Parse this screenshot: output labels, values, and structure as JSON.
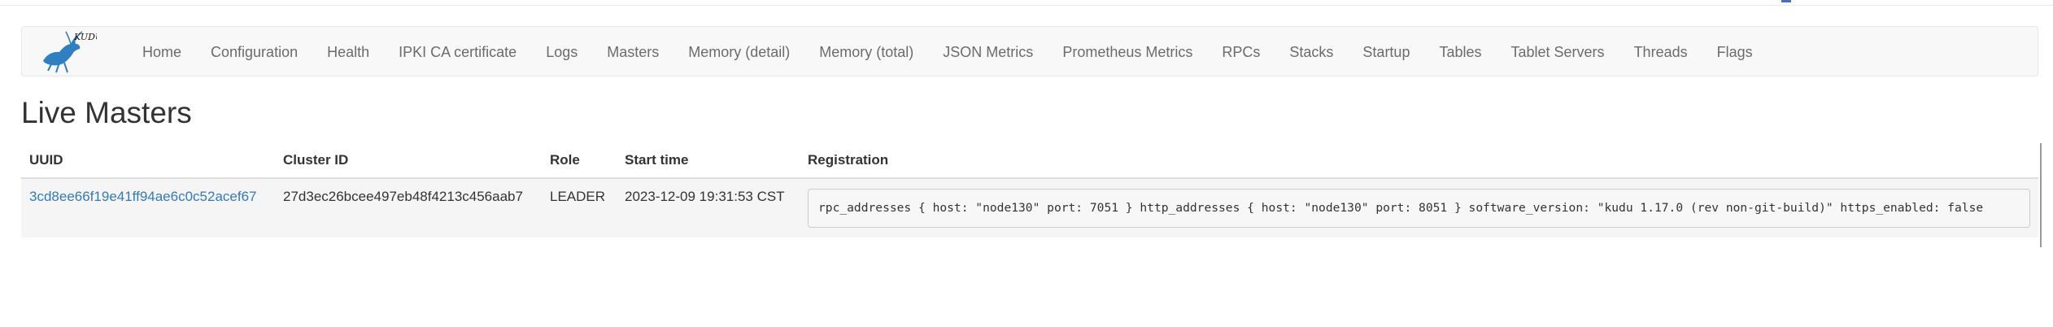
{
  "brand": {
    "logo_text": "KUDU",
    "colors": {
      "primary": "#2f7fc1",
      "text": "#1a1a1a"
    }
  },
  "nav": {
    "items": [
      {
        "label": "Home"
      },
      {
        "label": "Configuration"
      },
      {
        "label": "Health"
      },
      {
        "label": "IPKI CA certificate"
      },
      {
        "label": "Logs"
      },
      {
        "label": "Masters"
      },
      {
        "label": "Memory (detail)"
      },
      {
        "label": "Memory (total)"
      },
      {
        "label": "JSON Metrics"
      },
      {
        "label": "Prometheus Metrics"
      },
      {
        "label": "RPCs"
      },
      {
        "label": "Stacks"
      },
      {
        "label": "Startup"
      },
      {
        "label": "Tables"
      },
      {
        "label": "Tablet Servers"
      },
      {
        "label": "Threads"
      },
      {
        "label": "Flags"
      }
    ]
  },
  "page": {
    "title": "Live Masters"
  },
  "table": {
    "headers": {
      "uuid": "UUID",
      "cluster_id": "Cluster ID",
      "role": "Role",
      "start_time": "Start time",
      "registration": "Registration"
    },
    "rows": [
      {
        "uuid": "3cd8ee66f19e41ff94ae6c0c52acef67",
        "cluster_id": "27d3ec26bcee497eb48f4213c456aab7",
        "role": "LEADER",
        "start_time": "2023-12-09 19:31:53 CST",
        "registration": "rpc_addresses { host: \"node130\" port: 7051 } http_addresses { host: \"node130\" port: 8051 } software_version: \"kudu 1.17.0 (rev non-git-build)\" https_enabled: false"
      }
    ]
  },
  "colors": {
    "link": "#337ab7",
    "nav_text": "#6b6b6b",
    "navbar_bg": "#f8f8f8",
    "row_bg": "#f5f5f5"
  }
}
